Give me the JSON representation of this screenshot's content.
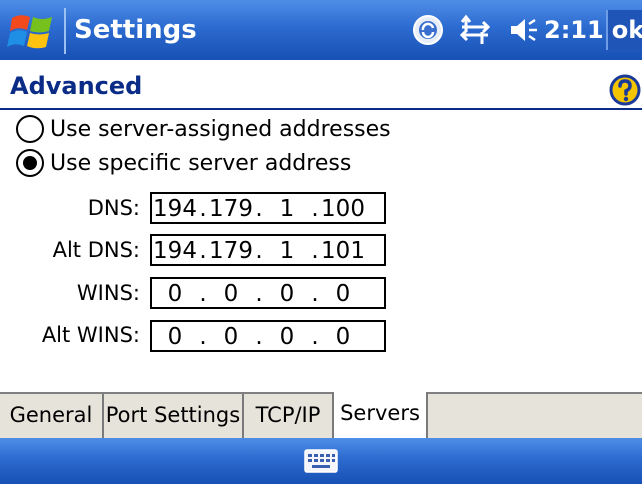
{
  "titlebar": {
    "app_title": "Settings",
    "clock": "2:11",
    "ok_label": "ok",
    "icons": [
      "windows-start-icon",
      "sync-icon",
      "connectivity-icon",
      "speaker-icon"
    ]
  },
  "header": {
    "title": "Advanced",
    "help_icon": "help-icon"
  },
  "options": {
    "server_assigned": {
      "label": "Use server-assigned addresses",
      "checked": false
    },
    "specific": {
      "label": "Use specific server address",
      "checked": true
    }
  },
  "fields": {
    "dns": {
      "label": "DNS:",
      "octets": [
        "194",
        "179",
        "1",
        "100"
      ]
    },
    "alt_dns": {
      "label": "Alt DNS:",
      "octets": [
        "194",
        "179",
        "1",
        "101"
      ]
    },
    "wins": {
      "label": "WINS:",
      "octets": [
        "0",
        "0",
        "0",
        "0"
      ]
    },
    "alt_wins": {
      "label": "Alt WINS:",
      "octets": [
        "0",
        "0",
        "0",
        "0"
      ]
    }
  },
  "tabs": [
    {
      "label": "General",
      "active": false
    },
    {
      "label": "Port Settings",
      "active": false
    },
    {
      "label": "TCP/IP",
      "active": false
    },
    {
      "label": "Servers",
      "active": true
    }
  ],
  "menubar": {
    "icon": "keyboard-icon"
  },
  "colors": {
    "titlebar_blue": "#2c6bd0",
    "header_text": "#0a2c87",
    "tab_bg": "#e6e3da"
  }
}
